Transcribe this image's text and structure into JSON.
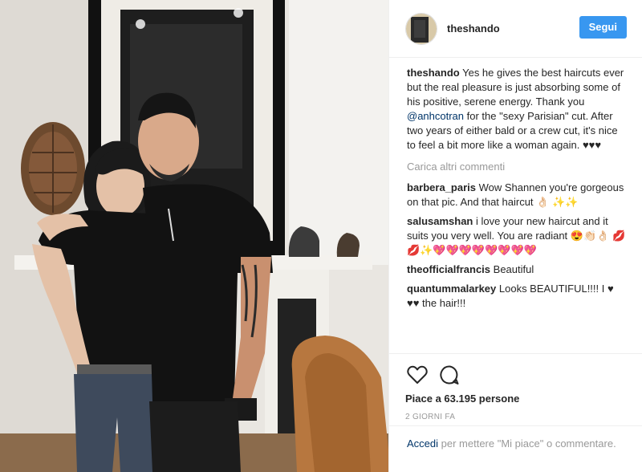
{
  "post": {
    "author": "theshando",
    "follow_label": "Segui",
    "caption": {
      "user": "theshando",
      "text_before": " Yes he gives the best haircuts ever but the real pleasure is just absorbing some of his positive, serene energy. Thank you ",
      "mention": "@anhcotran",
      "text_after": " for the \"sexy Parisian\" cut. After two years of either bald or a crew cut, it's nice to feel a bit more like a woman again. ♥♥♥"
    },
    "load_more_label": "Carica altri commenti",
    "comments": [
      {
        "user": "barbera_paris",
        "text": " Wow Shannen you're gorgeous on that pic. And that haircut 👌🏻 ✨✨"
      },
      {
        "user": "salusamshan",
        "text": " i love your new haircut and it suits you very well. You are radiant 😍👏🏻👌🏻 💋💋✨💖💖💖💖💖💖💖💖"
      },
      {
        "user": "theofficialfrancis",
        "text": " Beautiful"
      },
      {
        "user": "quantummalarkey",
        "text": " Looks BEAUTIFUL!!!! I ♥ ♥♥ the hair!!!"
      },
      {
        "user": "...",
        "text": " ..."
      }
    ],
    "likes_text": "Piace a 63.195 persone",
    "time_ago": "2 GIORNI FA",
    "login": {
      "link": "Accedi",
      "text": " per mettere \"Mi piace\" o commentare."
    }
  },
  "icons": {
    "like": "heart-icon",
    "comment": "comment-bubble-icon"
  },
  "colors": {
    "accent": "#3897f0",
    "link": "#003569",
    "muted": "#999999",
    "text": "#262626"
  }
}
